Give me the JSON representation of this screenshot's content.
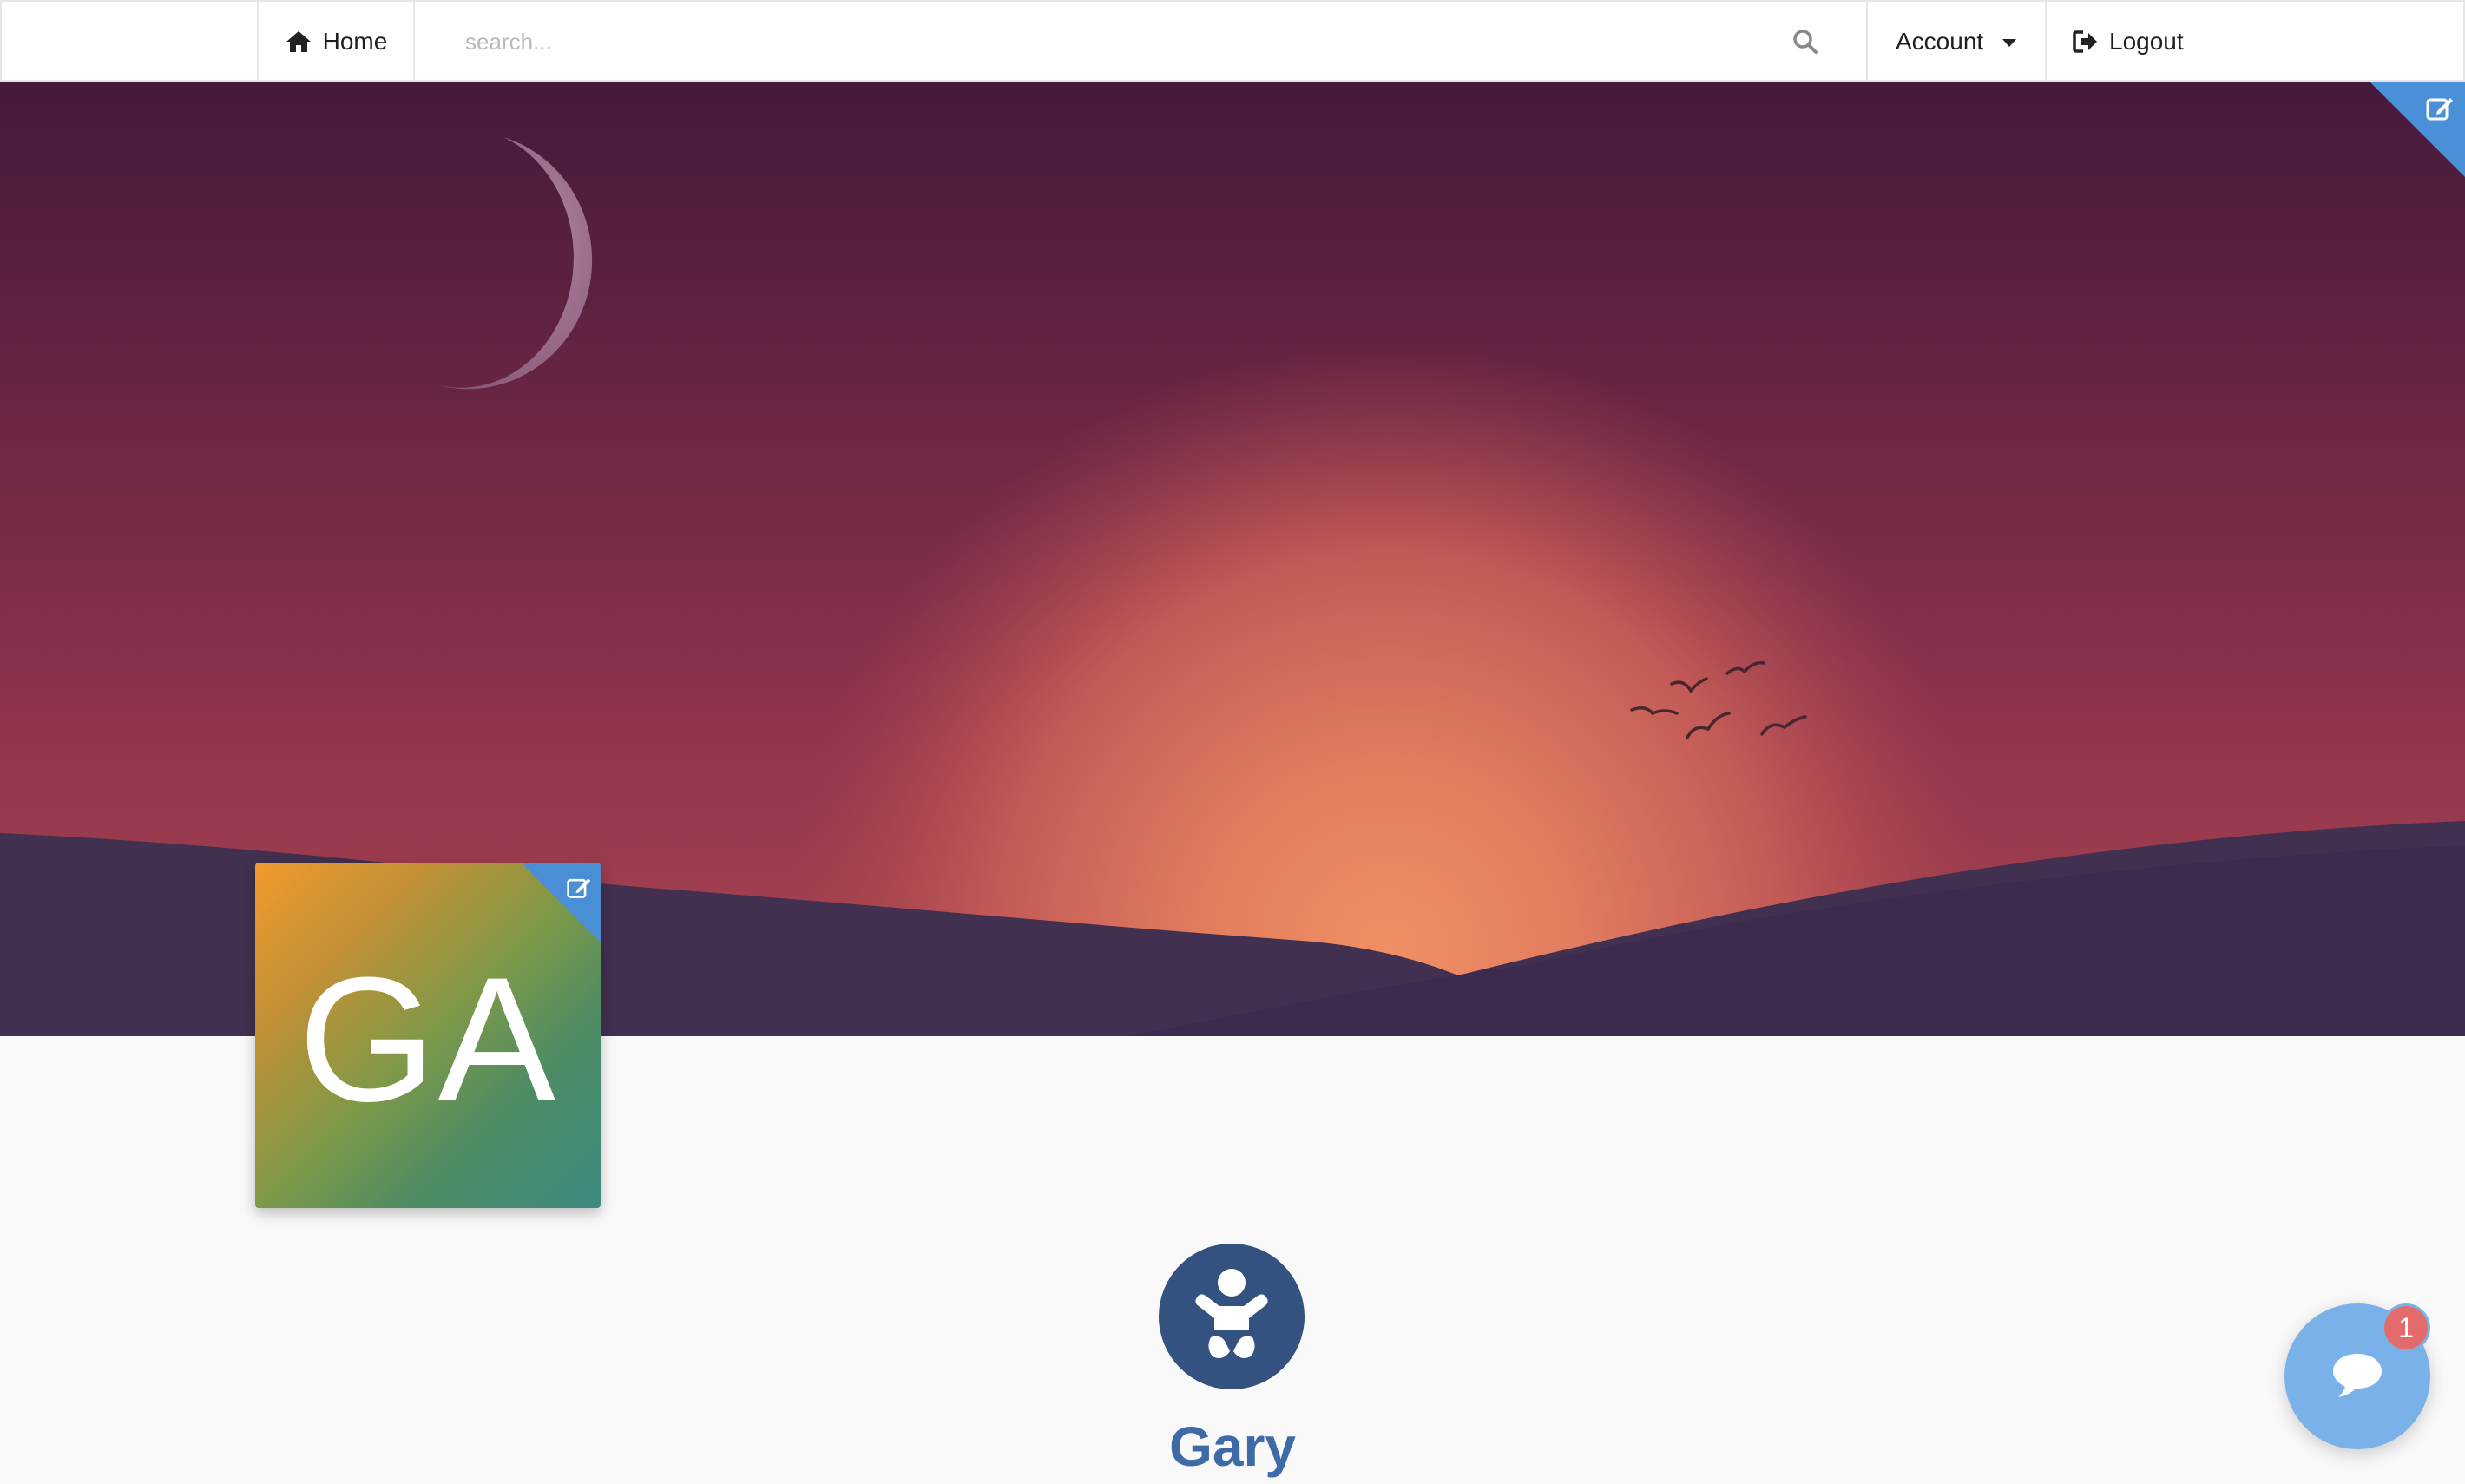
{
  "navbar": {
    "home_label": "Home",
    "search_placeholder": "search...",
    "account_label": "Account",
    "logout_label": "Logout"
  },
  "profile": {
    "avatar_initials": "GA",
    "name": "Gary"
  },
  "chat": {
    "unread_count": "1"
  },
  "icons": {
    "home": "home-icon",
    "search": "search-icon",
    "account_dropdown": "caret-down-icon",
    "logout": "sign-out-icon",
    "cover_edit": "edit-icon",
    "avatar_edit": "edit-icon",
    "profile_badge": "child-icon",
    "chat": "comment-icon"
  },
  "colors": {
    "accent_blue": "#4a90d9",
    "profile_badge_bg": "#34527f",
    "name_color": "#3f6aa8",
    "chat_button": "#79b1e8",
    "chat_badge": "#e46b6b"
  }
}
